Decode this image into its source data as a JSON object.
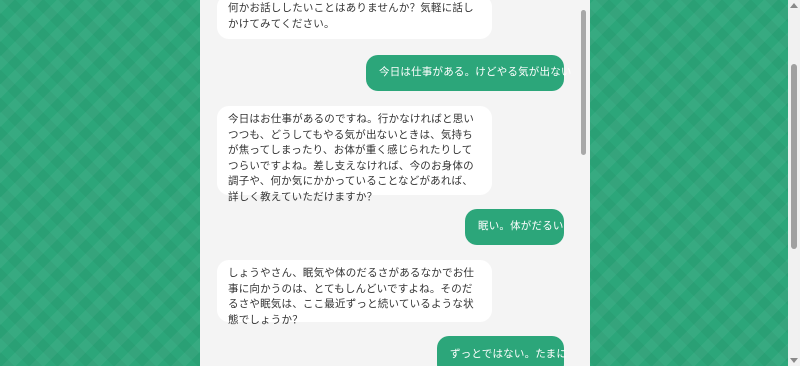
{
  "colors": {
    "accent": "#2ca67a",
    "panel_bg": "#f4f4f4",
    "ai_bubble_bg": "#ffffff",
    "user_bubble_text": "#ffffff"
  },
  "messages": [
    {
      "role": "assistant",
      "text": "何かお話ししたいことはありませんか？気軽に話しかけてみてください。"
    },
    {
      "role": "user",
      "text": "今日は仕事がある。けどやる気が出ない"
    },
    {
      "role": "assistant",
      "text": "今日はお仕事があるのですね。行かなければと思いつつも、どうしてもやる気が出ないときは、気持ちが焦ってしまったり、お体が重く感じられたりしてつらいですよね。差し支えなければ、今のお身体の調子や、何か気にかかっていることなどがあれば、詳しく教えていただけますか？"
    },
    {
      "role": "user",
      "text": "眠い。体がだるい"
    },
    {
      "role": "assistant",
      "text": "しょうやさん、眠気や体のだるさがあるなかでお仕事に向かうのは、とてもしんどいですよね。そのだるさや眠気は、ここ最近ずっと続いているような状態でしょうか？"
    },
    {
      "role": "user",
      "text": "ずっとではない。たまに"
    }
  ]
}
